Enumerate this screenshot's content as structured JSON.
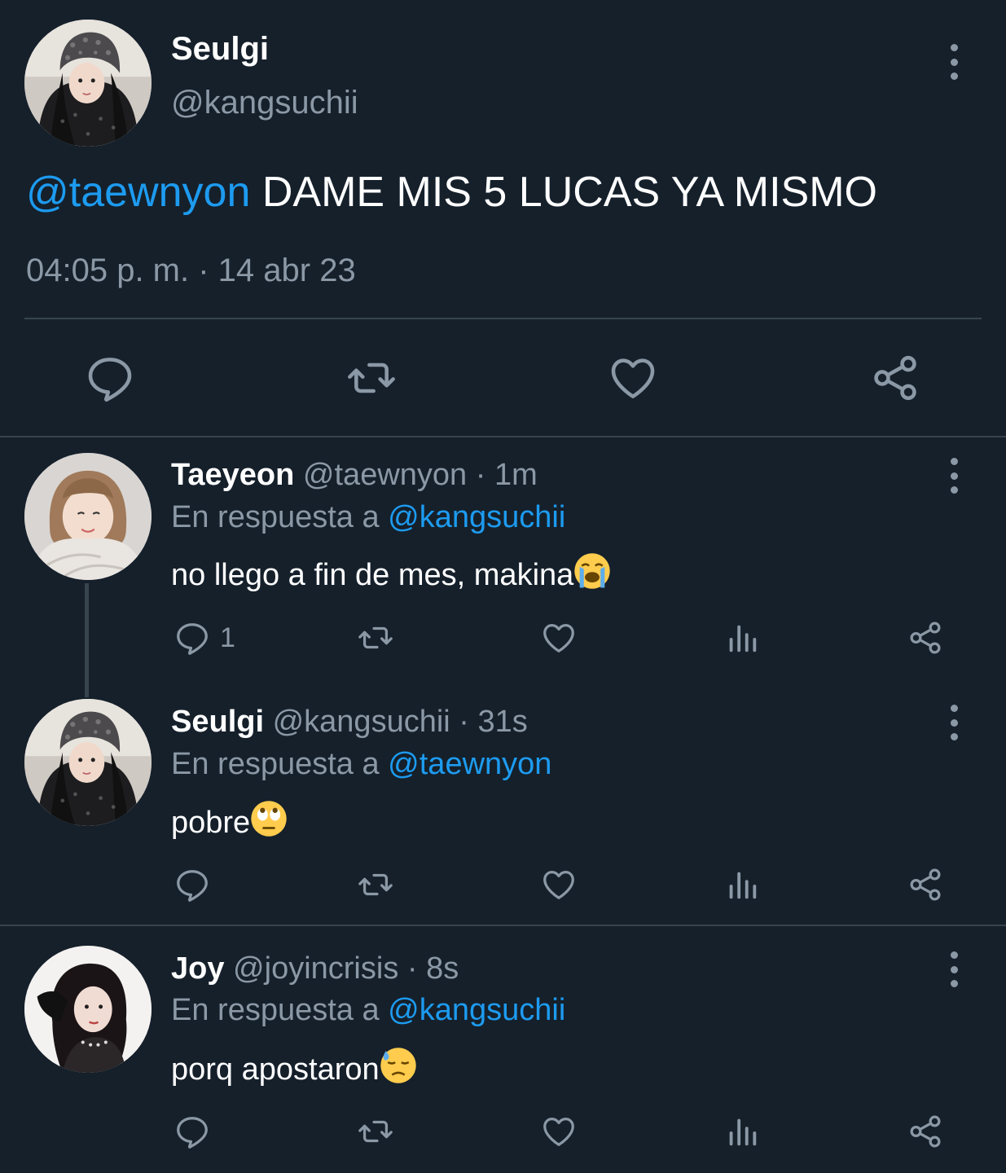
{
  "main_tweet": {
    "display_name": "Seulgi",
    "handle": "@kangsuchii",
    "mention": "@taewnyon",
    "text": "DAME MIS 5 LUCAS YA MISMO",
    "timestamp": "04:05 p. m. · 14 abr 23"
  },
  "replies": [
    {
      "display_name": "Taeyeon",
      "handle": "@taewnyon",
      "time": "· 1m",
      "reply_prefix": "En respuesta a",
      "reply_to": "@kangsuchii",
      "text": "no llego a fin de mes, makina",
      "emoji": "loudly-crying-face",
      "reply_count": "1"
    },
    {
      "display_name": "Seulgi",
      "handle": "@kangsuchii",
      "time": "· 31s",
      "reply_prefix": "En respuesta a",
      "reply_to": "@taewnyon",
      "text": "pobre",
      "emoji": "face-with-rolling-eyes",
      "reply_count": ""
    },
    {
      "display_name": "Joy",
      "handle": "@joyincrisis",
      "time": "· 8s",
      "reply_prefix": "En respuesta a",
      "reply_to": "@kangsuchii",
      "text": "porq apostaron",
      "emoji": "downcast-face-with-sweat",
      "reply_count": ""
    }
  ],
  "colors": {
    "background": "#15202b",
    "link": "#1d9bf0",
    "muted": "#8b98a5",
    "divider": "#38444d"
  },
  "icons": [
    "reply-icon",
    "retweet-icon",
    "like-icon",
    "analytics-icon",
    "share-icon",
    "more-options-icon"
  ]
}
